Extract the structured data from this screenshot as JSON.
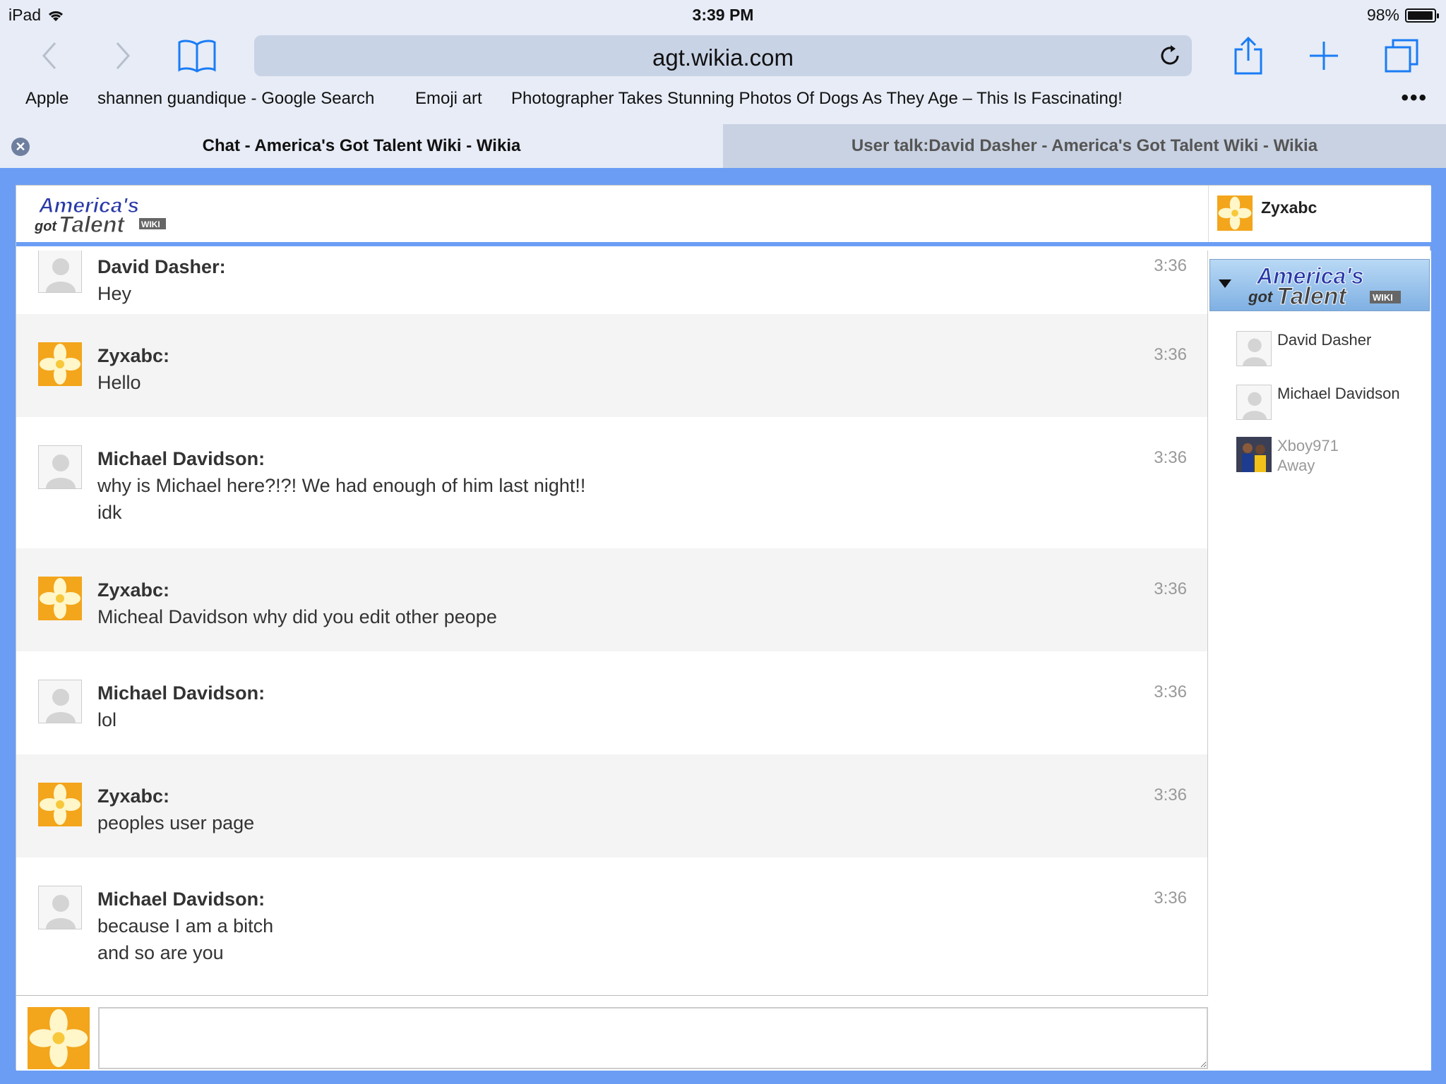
{
  "status_bar": {
    "device": "iPad",
    "time": "3:39 PM",
    "battery": "98%",
    "battery_level": 0.98
  },
  "browser": {
    "url": "agt.wikia.com",
    "bookmarks": [
      "Apple",
      "shannen guandique - Google Search",
      "Emoji art",
      "Photographer Takes Stunning Photos Of Dogs As They Age – This Is Fascinating!"
    ],
    "more": "•••",
    "tabs": [
      {
        "title": "Chat - America's Got Talent Wiki - Wikia",
        "active": true
      },
      {
        "title": "User talk:David Dasher - America's Got Talent Wiki - Wikia",
        "active": false
      }
    ]
  },
  "chat": {
    "current_user": "Zyxabc",
    "messages": [
      {
        "author": "David Dasher:",
        "lines": [
          "Hey"
        ],
        "time": "3:36",
        "avatar": "generic"
      },
      {
        "author": "Zyxabc:",
        "lines": [
          "Hello"
        ],
        "time": "3:36",
        "avatar": "flower"
      },
      {
        "author": "Michael Davidson:",
        "lines": [
          "why is Michael here?!?! We had enough of him last night!!",
          "idk"
        ],
        "time": "3:36",
        "avatar": "generic"
      },
      {
        "author": "Zyxabc:",
        "lines": [
          "Micheal Davidson why did you edit other peope"
        ],
        "time": "3:36",
        "avatar": "flower"
      },
      {
        "author": "Michael Davidson:",
        "lines": [
          "lol"
        ],
        "time": "3:36",
        "avatar": "generic"
      },
      {
        "author": "Zyxabc:",
        "lines": [
          "peoples user page"
        ],
        "time": "3:36",
        "avatar": "flower"
      },
      {
        "author": "Michael Davidson:",
        "lines": [
          "because I am a bitch",
          "and so are you"
        ],
        "time": "3:36",
        "avatar": "generic"
      }
    ],
    "users": [
      {
        "name": "David Dasher",
        "status": "",
        "avatar": "generic"
      },
      {
        "name": "Michael Davidson",
        "status": "",
        "avatar": "generic"
      },
      {
        "name": "Xboy971",
        "status": "Away",
        "avatar": "photo"
      }
    ],
    "input_value": ""
  },
  "colors": {
    "frame_blue": "#6b9df5",
    "alt_row": "#f4f4f4",
    "ios_blue": "#1a7cf5"
  }
}
